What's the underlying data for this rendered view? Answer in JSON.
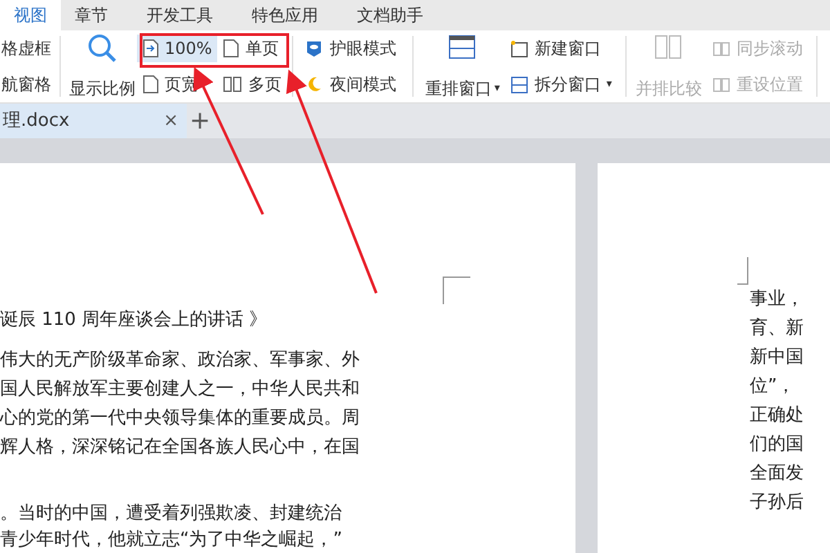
{
  "tabs": [
    {
      "label": "视图",
      "selected": true
    },
    {
      "label": "章节",
      "selected": false
    },
    {
      "label": "开发工具",
      "selected": false
    },
    {
      "label": "特色应用",
      "selected": false
    },
    {
      "label": "文档助手",
      "selected": false
    }
  ],
  "ribbon": {
    "cut_column": [
      "格虚框",
      "航窗格"
    ],
    "zoom_button": {
      "label": "显示比例"
    },
    "view_column_a": [
      {
        "label": "100%",
        "selected": true
      },
      {
        "label": "页宽",
        "selected": false
      }
    ],
    "view_column_b": [
      {
        "label": "单页",
        "selected": false
      },
      {
        "label": "多页",
        "selected": false
      }
    ],
    "mode_column": [
      "护眼模式",
      "夜间模式"
    ],
    "arrange_button": {
      "label": "重排窗口",
      "dropdown": "▾"
    },
    "window_column": [
      {
        "label": "新建窗口"
      },
      {
        "label": "拆分窗口",
        "dropdown": "▾"
      }
    ],
    "compare_button": {
      "label": "并排比较",
      "disabled": true
    },
    "sync_column": [
      {
        "label": "同步滚动",
        "disabled": true
      },
      {
        "label": "重设位置",
        "disabled": true
      }
    ]
  },
  "document_tab": {
    "title": "理.docx",
    "close": "×",
    "add": "+"
  },
  "left_page": {
    "heading": "诞辰 110 周年座谈会上的讲话 》",
    "lines": [
      "伟大的无产阶级革命家、政治家、军事家、外",
      "国人民解放军主要创建人之一，中华人民共和",
      "心的党的第一代中央领导集体的重要成员。周",
      "辉人格，深深铭记在全国各族人民心中，在国"
    ],
    "lines_2": [
      "。当时的中国，遭受着列强欺凌、封建统治",
      "青少年时代，他就立志“为了中华之崛起，”"
    ]
  },
  "right_page": {
    "lines": [
      "事业，",
      "育、新",
      "新中国",
      "位”，",
      "正确处",
      "们的国",
      "全面发",
      "子孙后"
    ]
  }
}
